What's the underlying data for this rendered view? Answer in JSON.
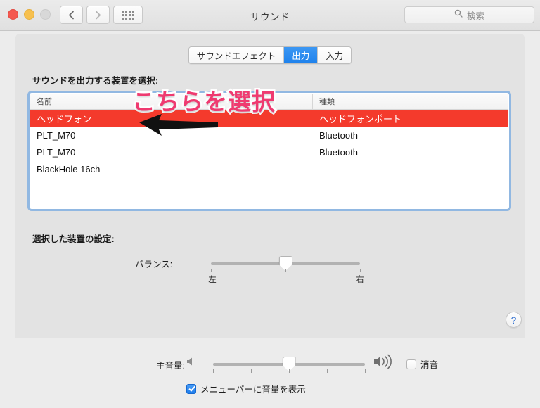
{
  "window": {
    "title": "サウンド",
    "traffic_lights": [
      "close",
      "minimize",
      "zoom"
    ]
  },
  "toolbar": {
    "back_icon": "chevron-left-icon",
    "forward_icon": "chevron-right-icon",
    "show_all_icon": "grid-icon",
    "search": {
      "icon": "search-icon",
      "placeholder": "検索",
      "value": ""
    }
  },
  "tabs": [
    {
      "label": "サウンドエフェクト",
      "selected": false
    },
    {
      "label": "出力",
      "selected": true
    },
    {
      "label": "入力",
      "selected": false
    }
  ],
  "devices": {
    "label": "サウンドを出力する装置を選択:",
    "columns": [
      "名前",
      "種類"
    ],
    "rows": [
      {
        "name": "ヘッドフォン",
        "type": "ヘッドフォンポート",
        "selected": true
      },
      {
        "name": "PLT_M70",
        "type": "Bluetooth",
        "selected": false
      },
      {
        "name": "PLT_M70",
        "type": "Bluetooth",
        "selected": false
      },
      {
        "name": "BlackHole 16ch",
        "type": "",
        "selected": false
      }
    ]
  },
  "settings": {
    "label": "選択した装置の設定:",
    "balance": {
      "label": "バランス:",
      "value_percent": 50,
      "min_label": "左",
      "max_label": "右"
    }
  },
  "help": {
    "label": "?"
  },
  "volume": {
    "label": "主音量:",
    "low_icon": "speaker-low-icon",
    "high_icon": "speaker-high-icon",
    "value_percent": 50,
    "mute": {
      "label": "消音",
      "checked": false
    }
  },
  "menubar_option": {
    "label": "メニューバーに音量を表示",
    "checked": true
  },
  "annotations": {
    "text": "こちらを選択",
    "text_color": "#ef3a70",
    "arrow_icon": "arrow-left-icon",
    "arrow_color": "#111111"
  },
  "colors": {
    "accent_blue": "#1f82ec",
    "selected_row_red": "#f43a2c",
    "window_background": "#ececec",
    "panel_background": "#e3e3e3"
  }
}
